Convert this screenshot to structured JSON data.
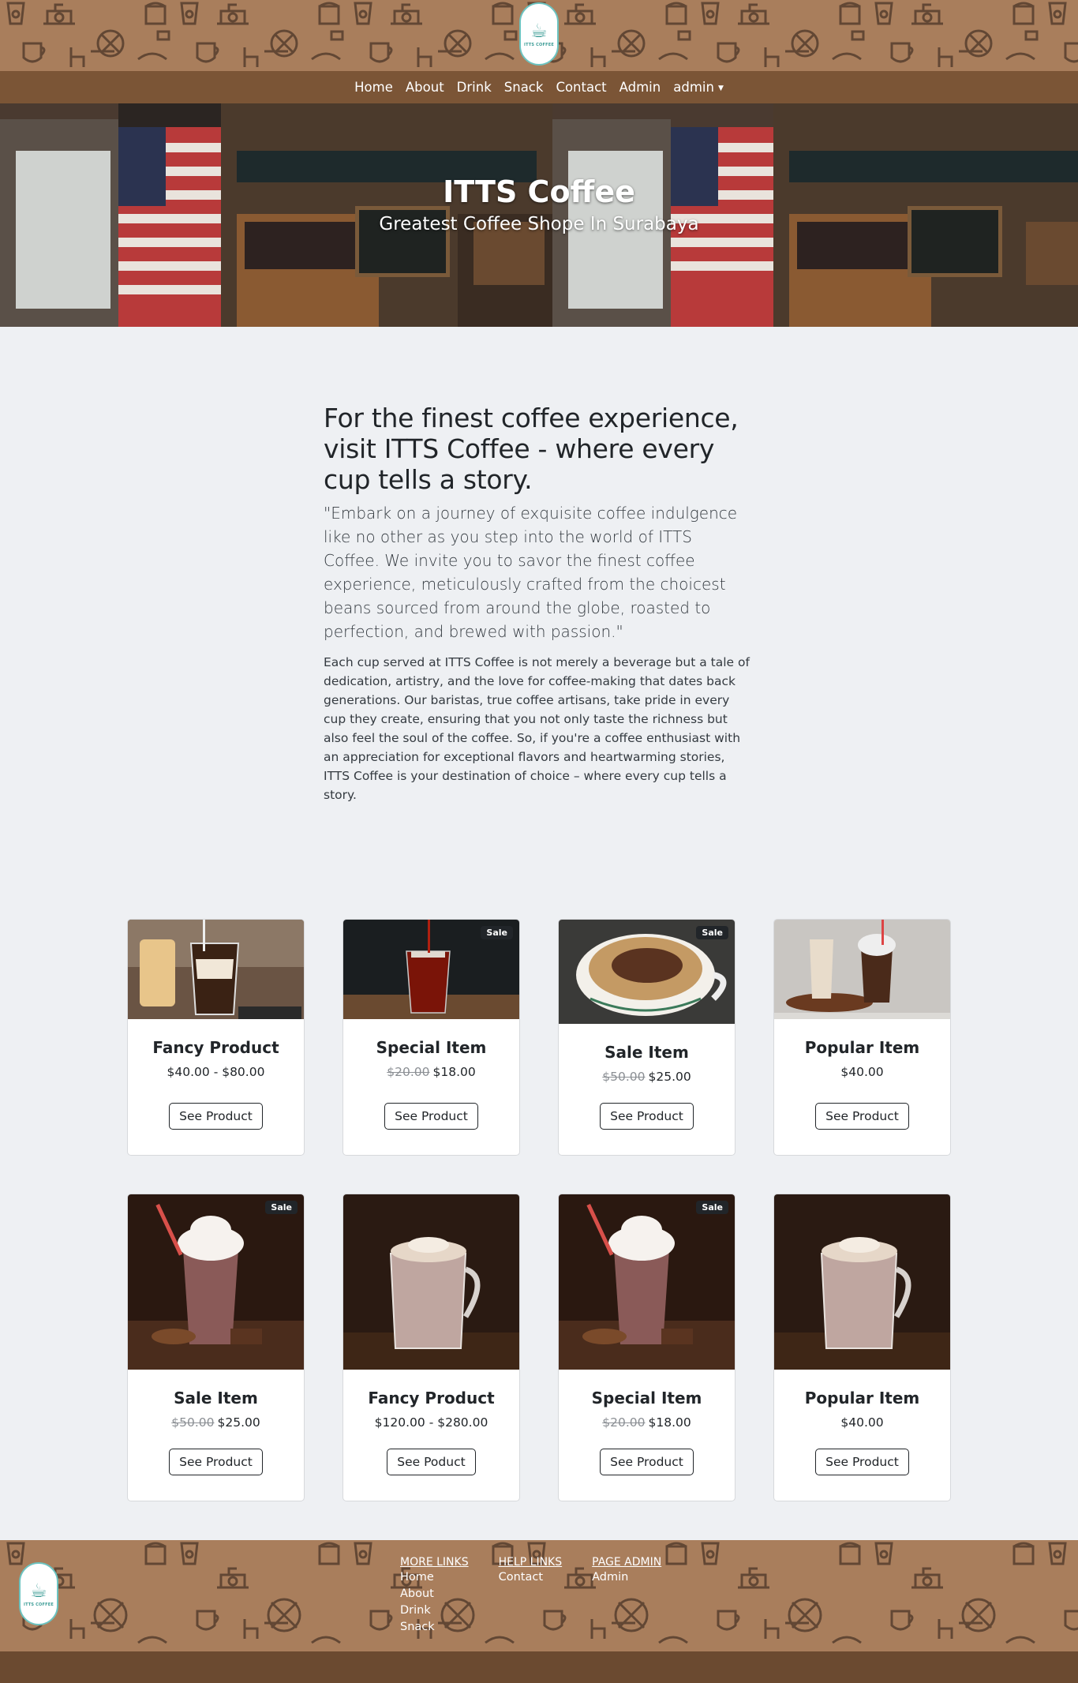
{
  "brand": {
    "logo_text": "ITTS COFFEE",
    "pattern_color": "#a97e5c",
    "nav_color": "#7b5536"
  },
  "nav": {
    "items": [
      "Home",
      "About",
      "Drink",
      "Snack",
      "Contact",
      "Admin"
    ],
    "user_label": "admin"
  },
  "hero": {
    "title": "ITTS Coffee",
    "subtitle": "Greatest Coffee Shope In Surabaya"
  },
  "about": {
    "heading": "For the finest coffee experience, visit ITTS Coffee - where every cup tells a story.",
    "lead": "\"Embark on a journey of exquisite coffee indulgence like no other as you step into the world of ITTS Coffee. We invite you to savor the finest coffee experience, meticulously crafted from the choicest beans sourced from around the globe, roasted to perfection, and brewed with passion.\"",
    "body": "Each cup served at ITTS Coffee is not merely a beverage but a tale of dedication, artistry, and the love for coffee-making that dates back generations. Our baristas, true coffee artisans, take pride in every cup they create, ensuring that you not only taste the richness but also feel the soul of the coffee. So, if you're a coffee enthusiast with an appreciation for exceptional flavors and heartwarming stories, ITTS Coffee is your destination of choice – where every cup tells a story."
  },
  "products": [
    {
      "name": "Fancy Product",
      "price": "$40.00 - $80.00",
      "old_price": "",
      "sale": false,
      "sale_label": "",
      "button": "See Product",
      "image": "iced-coffee"
    },
    {
      "name": "Special Item",
      "price": "$18.00",
      "old_price": "$20.00",
      "sale": true,
      "sale_label": "Sale",
      "button": "See Product",
      "image": "iced-americano"
    },
    {
      "name": "Sale Item",
      "price": "$25.00",
      "old_price": "$50.00",
      "sale": true,
      "sale_label": "Sale",
      "button": "See Product",
      "image": "cappuccino"
    },
    {
      "name": "Popular Item",
      "price": "$40.00",
      "old_price": "",
      "sale": false,
      "sale_label": "",
      "button": "See Product",
      "image": "milkshakes"
    },
    {
      "name": "Sale Item",
      "price": "$25.00",
      "old_price": "$50.00",
      "sale": true,
      "sale_label": "Sale",
      "button": "See Product",
      "image": "chocolate-frappe"
    },
    {
      "name": "Fancy Product",
      "price": "$120.00 - $280.00",
      "old_price": "",
      "sale": false,
      "sale_label": "",
      "button": "See Poduct",
      "image": "hot-chocolate"
    },
    {
      "name": "Special Item",
      "price": "$18.00",
      "old_price": "$20.00",
      "sale": true,
      "sale_label": "Sale",
      "button": "See Product",
      "image": "chocolate-frappe"
    },
    {
      "name": "Popular Item",
      "price": "$40.00",
      "old_price": "",
      "sale": false,
      "sale_label": "",
      "button": "See Product",
      "image": "hot-chocolate"
    }
  ],
  "footer": {
    "columns": [
      {
        "title": "MORE LINKS",
        "links": [
          "Home",
          "About",
          "Drink",
          "Snack"
        ]
      },
      {
        "title": "HELP LINKS",
        "links": [
          "Contact"
        ]
      },
      {
        "title": "PAGE ADMIN",
        "links": [
          "Admin"
        ]
      }
    ]
  }
}
